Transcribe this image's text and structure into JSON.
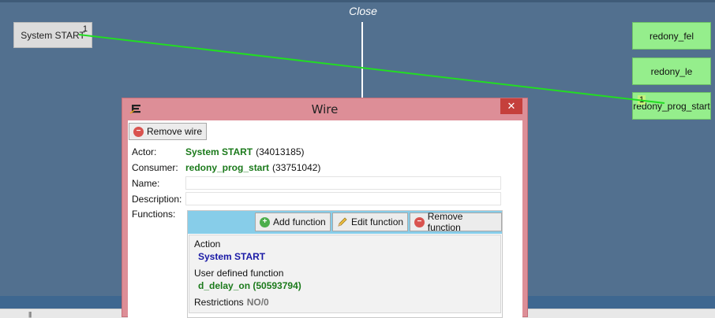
{
  "canvas": {
    "close_label": "Close",
    "wire_color": "#22dd22"
  },
  "nodes": {
    "system_start": {
      "label": "System START",
      "badge": "1"
    },
    "redony_fel": {
      "label": "redony_fel"
    },
    "redony_le": {
      "label": "redony_le"
    },
    "redony_prog_start": {
      "label": "redony_prog_start",
      "badge": "1"
    }
  },
  "scrollbar": {
    "grip": "|||"
  },
  "dialog": {
    "title": "Wire",
    "close_glyph": "✕",
    "remove_wire_label": "Remove wire",
    "actor": {
      "label": "Actor:",
      "name": "System START",
      "id": "(34013185)"
    },
    "consumer": {
      "label": "Consumer:",
      "name": "redony_prog_start",
      "id": "(33751042)"
    },
    "name_label": "Name:",
    "name_value": "",
    "description_label": "Description:",
    "description_value": "",
    "functions_label": "Functions:",
    "toolbar": {
      "add_label": "Add function",
      "edit_label": "Edit function",
      "remove_label": "Remove function"
    },
    "function_item": {
      "action_label": "Action",
      "action_value": "System START",
      "udf_label": "User defined function",
      "udf_value": "d_delay_on (50593794)",
      "restrictions_label": "Restrictions",
      "restrictions_value": "NO/0"
    }
  },
  "colors": {
    "canvas_bg": "#52708f",
    "node_green": "#95ee8c",
    "dialog_frame": "#dd8e97",
    "toolbar_bg": "#87cde9",
    "accent_green": "#1b7a1b",
    "accent_blue": "#1a1aa6"
  }
}
